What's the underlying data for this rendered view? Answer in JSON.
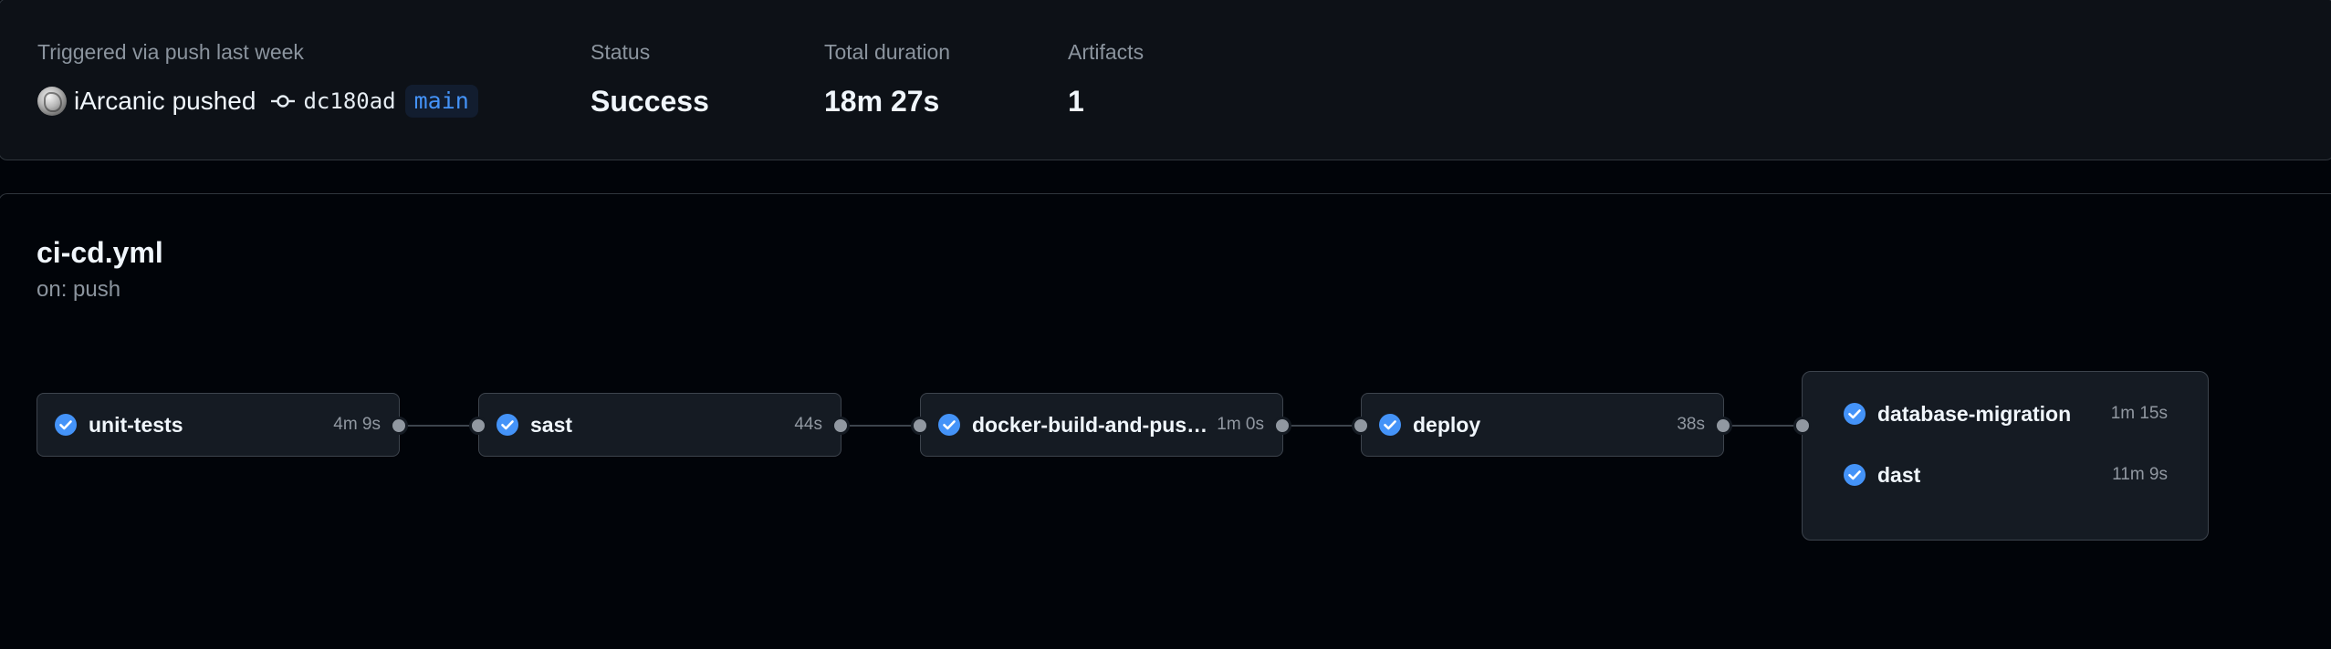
{
  "summary": {
    "trigger_label": "Triggered via push last week",
    "actor": "iArcanic",
    "action": "pushed",
    "commit_sha": "dc180ad",
    "branch": "main",
    "status_label": "Status",
    "status_value": "Success",
    "duration_label": "Total duration",
    "duration_value": "18m 27s",
    "artifacts_label": "Artifacts",
    "artifacts_value": "1"
  },
  "workflow": {
    "file": "ci-cd.yml",
    "trigger": "on: push",
    "jobs": [
      {
        "name": "unit-tests",
        "duration": "4m 9s",
        "status": "success"
      },
      {
        "name": "sast",
        "duration": "44s",
        "status": "success"
      },
      {
        "name": "docker-build-and-push-...",
        "duration": "1m 0s",
        "status": "success"
      },
      {
        "name": "deploy",
        "duration": "38s",
        "status": "success"
      }
    ],
    "final_group": [
      {
        "name": "database-migration",
        "duration": "1m 15s",
        "status": "success"
      },
      {
        "name": "dast",
        "duration": "11m 9s",
        "status": "success"
      }
    ]
  },
  "colors": {
    "success": "#4493f8",
    "background": "#010409",
    "card": "#151b23",
    "border": "#3d444d"
  },
  "icons": {
    "job_status": "check-circle-icon",
    "commit": "git-commit-icon"
  }
}
